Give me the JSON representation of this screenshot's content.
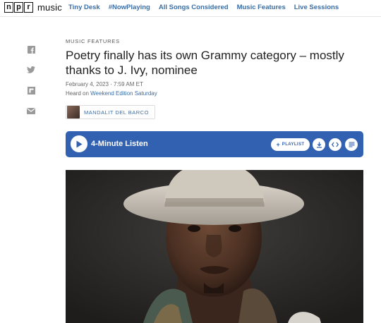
{
  "header": {
    "logo_letters": [
      "n",
      "p",
      "r"
    ],
    "logo_suffix": "music",
    "nav": [
      "Tiny Desk",
      "#NowPlaying",
      "All Songs Considered",
      "Music Features",
      "Live Sessions"
    ]
  },
  "share_icons": [
    "facebook-icon",
    "twitter-icon",
    "flipboard-icon",
    "email-icon"
  ],
  "article": {
    "kicker": "MUSIC FEATURES",
    "title": "Poetry finally has its own Grammy category – mostly thanks to J. Ivy, nominee",
    "date": "February 4, 2023 · 7:59 AM ET",
    "heard_prefix": "Heard on ",
    "heard_link": "Weekend Edition Saturday",
    "author": "MANDALIT DEL BARCO"
  },
  "player": {
    "title": "4-Minute Listen",
    "playlist_label": "PLAYLIST",
    "accent": "#3161b0"
  },
  "colors": {
    "link": "#3b6ea5",
    "text": "#222222"
  }
}
